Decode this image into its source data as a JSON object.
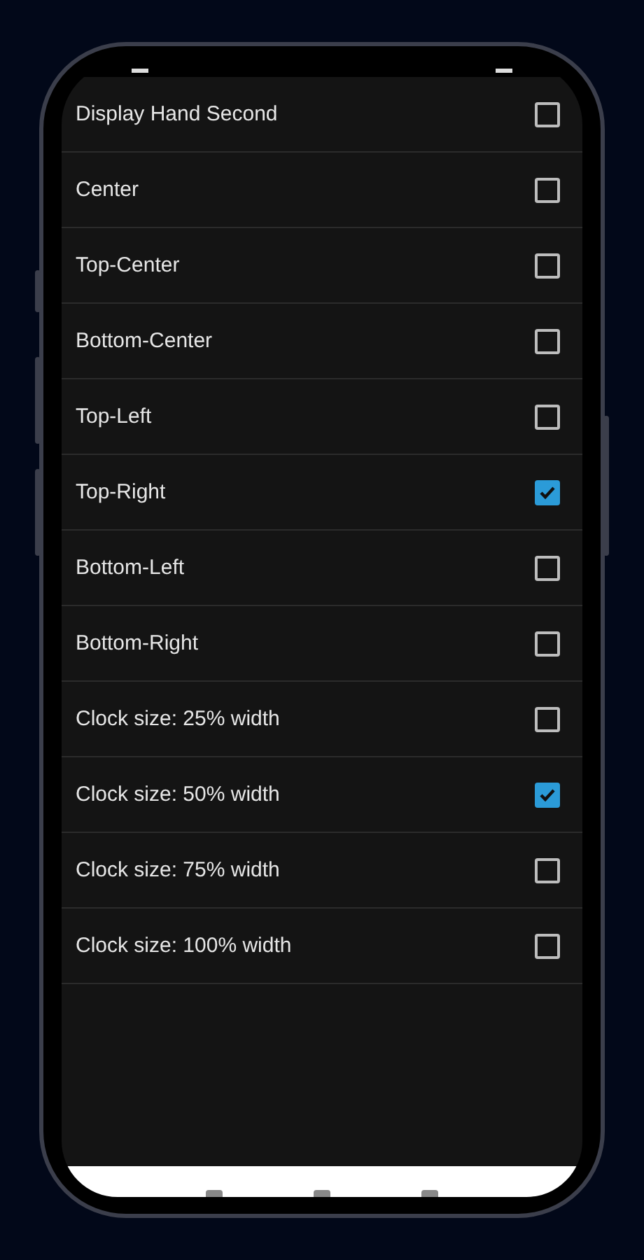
{
  "options": [
    {
      "label": "Display Hand Second",
      "checked": false
    },
    {
      "label": "Center",
      "checked": false
    },
    {
      "label": "Top-Center",
      "checked": false
    },
    {
      "label": "Bottom-Center",
      "checked": false
    },
    {
      "label": "Top-Left",
      "checked": false
    },
    {
      "label": "Top-Right",
      "checked": true
    },
    {
      "label": "Bottom-Left",
      "checked": false
    },
    {
      "label": "Bottom-Right",
      "checked": false
    },
    {
      "label": "Clock size: 25% width",
      "checked": false
    },
    {
      "label": "Clock size: 50% width",
      "checked": true
    },
    {
      "label": "Clock size: 75% width",
      "checked": false
    },
    {
      "label": "Clock size: 100% width",
      "checked": false
    }
  ]
}
